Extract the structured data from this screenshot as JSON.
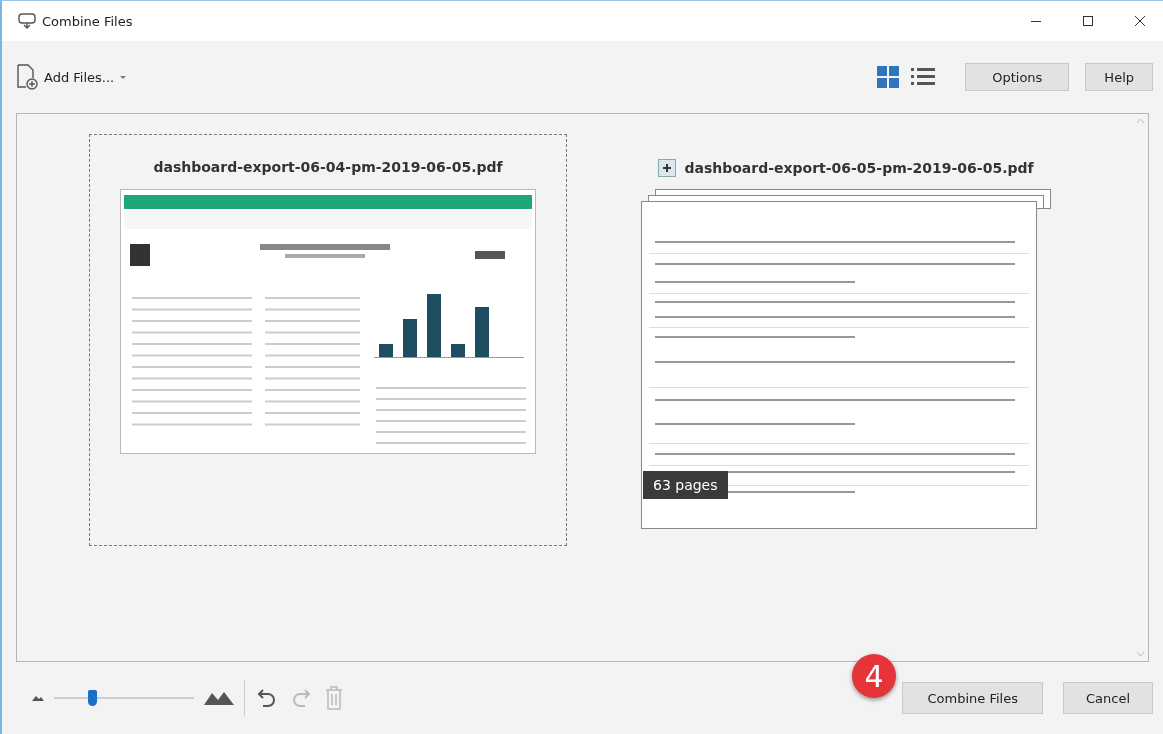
{
  "window": {
    "title": "Combine Files"
  },
  "toolbar": {
    "add_files": "Add Files...",
    "views": [
      {
        "kind": "grid",
        "selected": true
      },
      {
        "kind": "list",
        "selected": false
      }
    ],
    "buttons": [
      "Options",
      "Help"
    ]
  },
  "files": [
    {
      "kind": "single",
      "name": "dashboard-export-06-04-pm-2019-06-05.pdf",
      "selected": true
    },
    {
      "kind": "stack",
      "name": "dashboard-export-06-05-pm-2019-06-05.pdf",
      "selected": false,
      "pages_badge": "63 pages"
    }
  ],
  "footer": {
    "zoom": {
      "level": 0.27
    },
    "actions": [
      {
        "kind": "undo",
        "disabled": false
      },
      {
        "kind": "redo",
        "disabled": true
      },
      {
        "kind": "delete",
        "disabled": true
      }
    ],
    "step_badge": "4",
    "buttons": [
      "Combine Files",
      "Cancel"
    ]
  }
}
